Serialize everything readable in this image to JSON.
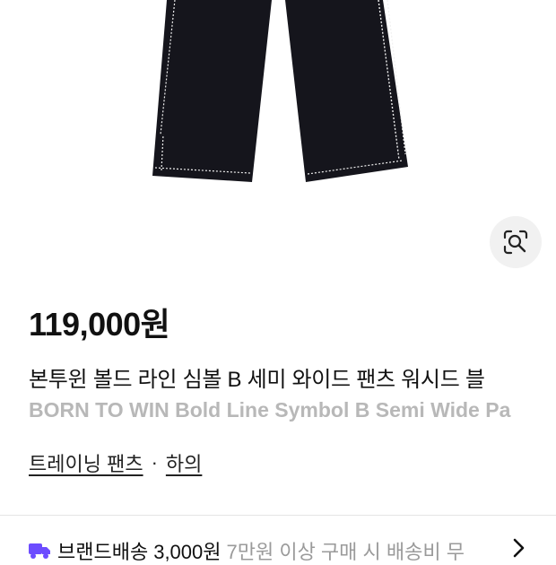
{
  "product": {
    "price": "119,000원",
    "title_ko": "본투윈 볼드 라인 심볼 B 세미 와이드 팬츠 워시드 블",
    "title_en": "BORN TO WIN Bold Line Symbol B Semi Wide Pa",
    "category": {
      "primary": "트레이닝 팬츠",
      "separator": "·",
      "secondary": "하의"
    }
  },
  "shipping": {
    "title": "브랜드배송",
    "fee": "3,000원",
    "note": "7만원 이상 구매 시 배송비 무"
  },
  "icons": {
    "visual_search": "lens-scan-icon",
    "shipping": "truck-icon",
    "more": "chevron-right-icon"
  },
  "colors": {
    "accent": "#6c4cff",
    "pants": "#15151c",
    "stitching": "#e8e8e8"
  }
}
